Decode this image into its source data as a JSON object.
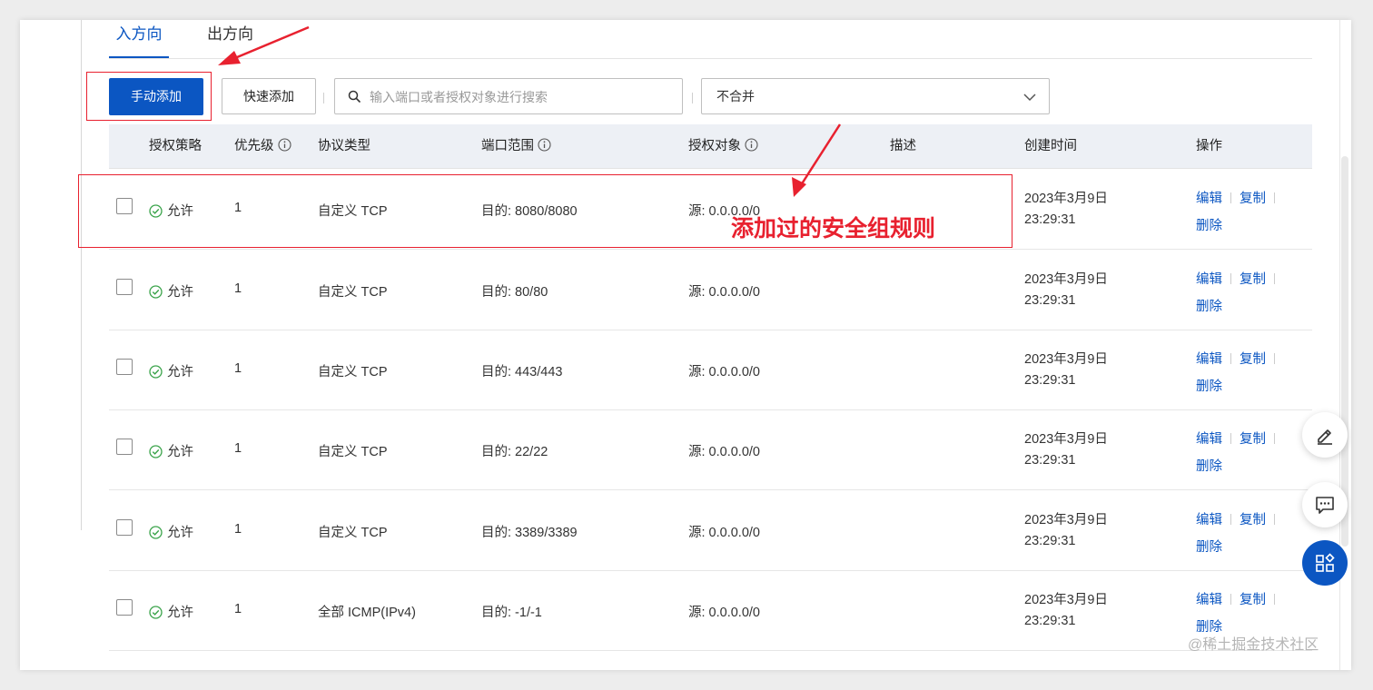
{
  "tabs": {
    "inbound": "入方向",
    "outbound": "出方向"
  },
  "toolbar": {
    "manual_add": "手动添加",
    "quick_add": "快速添加",
    "search_placeholder": "输入端口或者授权对象进行搜索",
    "merge_select": "不合并"
  },
  "table": {
    "headers": {
      "policy": "授权策略",
      "priority": "优先级",
      "protocol": "协议类型",
      "port_range": "端口范围",
      "auth_object": "授权对象",
      "description": "描述",
      "created": "创建时间",
      "actions": "操作"
    },
    "rows": [
      {
        "policy": "允许",
        "priority": "1",
        "protocol": "自定义 TCP",
        "port": "目的: 8080/8080",
        "source": "源: 0.0.0.0/0",
        "date": "2023年3月9日",
        "time": "23:29:31"
      },
      {
        "policy": "允许",
        "priority": "1",
        "protocol": "自定义 TCP",
        "port": "目的: 80/80",
        "source": "源: 0.0.0.0/0",
        "date": "2023年3月9日",
        "time": "23:29:31"
      },
      {
        "policy": "允许",
        "priority": "1",
        "protocol": "自定义 TCP",
        "port": "目的: 443/443",
        "source": "源: 0.0.0.0/0",
        "date": "2023年3月9日",
        "time": "23:29:31"
      },
      {
        "policy": "允许",
        "priority": "1",
        "protocol": "自定义 TCP",
        "port": "目的: 22/22",
        "source": "源: 0.0.0.0/0",
        "date": "2023年3月9日",
        "time": "23:29:31"
      },
      {
        "policy": "允许",
        "priority": "1",
        "protocol": "自定义 TCP",
        "port": "目的: 3389/3389",
        "source": "源: 0.0.0.0/0",
        "date": "2023年3月9日",
        "time": "23:29:31"
      },
      {
        "policy": "允许",
        "priority": "1",
        "protocol": "全部 ICMP(IPv4)",
        "port": "目的: -1/-1",
        "source": "源: 0.0.0.0/0",
        "date": "2023年3月9日",
        "time": "23:29:31"
      }
    ],
    "actions": {
      "edit": "编辑",
      "copy": "复制",
      "delete": "删除"
    }
  },
  "annotation": {
    "label": "添加过的安全组规则"
  },
  "watermark": "@稀土掘金技术社区",
  "colors": {
    "primary": "#0b56c2",
    "annotation_red": "#e8212f",
    "allow_green": "#3aa34a",
    "header_bg": "#edf0f5"
  },
  "icons": [
    "search-icon",
    "chevron-down-icon",
    "info-icon",
    "check-circle-icon",
    "edit-icon",
    "chat-icon",
    "apps-icon"
  ]
}
